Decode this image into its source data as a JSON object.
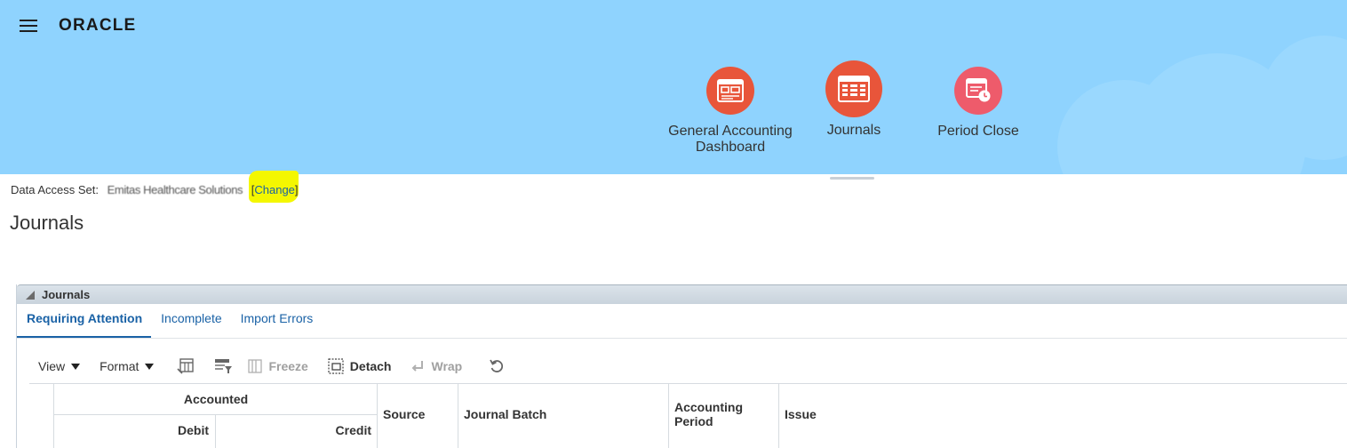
{
  "header": {
    "logo": "ORACLE",
    "nav": [
      {
        "label_line1": "General Accounting",
        "label_line2": "Dashboard",
        "icon": "dashboard-icon",
        "color": "#e8553a"
      },
      {
        "label_line1": "Journals",
        "label_line2": "",
        "icon": "journals-table-icon",
        "color": "#e8553a"
      },
      {
        "label_line1": "Period Close",
        "label_line2": "",
        "icon": "period-close-icon",
        "color": "#ee5b6b"
      }
    ]
  },
  "data_access": {
    "label": "Data Access Set:",
    "value": "Emitas Healthcare Solutions",
    "open_bracket": "[",
    "change": "Change",
    "close_bracket": "]",
    "highlight_color": "#f4f700"
  },
  "page_title": "Journals",
  "panel": {
    "title": "Journals",
    "tabs": [
      "Requiring Attention",
      "Incomplete",
      "Import Errors"
    ],
    "active_tab": "Requiring Attention",
    "toolbar": {
      "view": "View",
      "format": "Format",
      "freeze": "Freeze",
      "detach": "Detach",
      "wrap": "Wrap"
    },
    "columns": {
      "accounted": "Accounted",
      "debit": "Debit",
      "credit": "Credit",
      "source": "Source",
      "journal_batch": "Journal Batch",
      "accounting_period_line1": "Accounting",
      "accounting_period_line2": "Period",
      "issue": "Issue"
    }
  },
  "colors": {
    "banner": "#8fd3fe",
    "link": "#1a62a6",
    "nav_icon": "#e8553a"
  }
}
